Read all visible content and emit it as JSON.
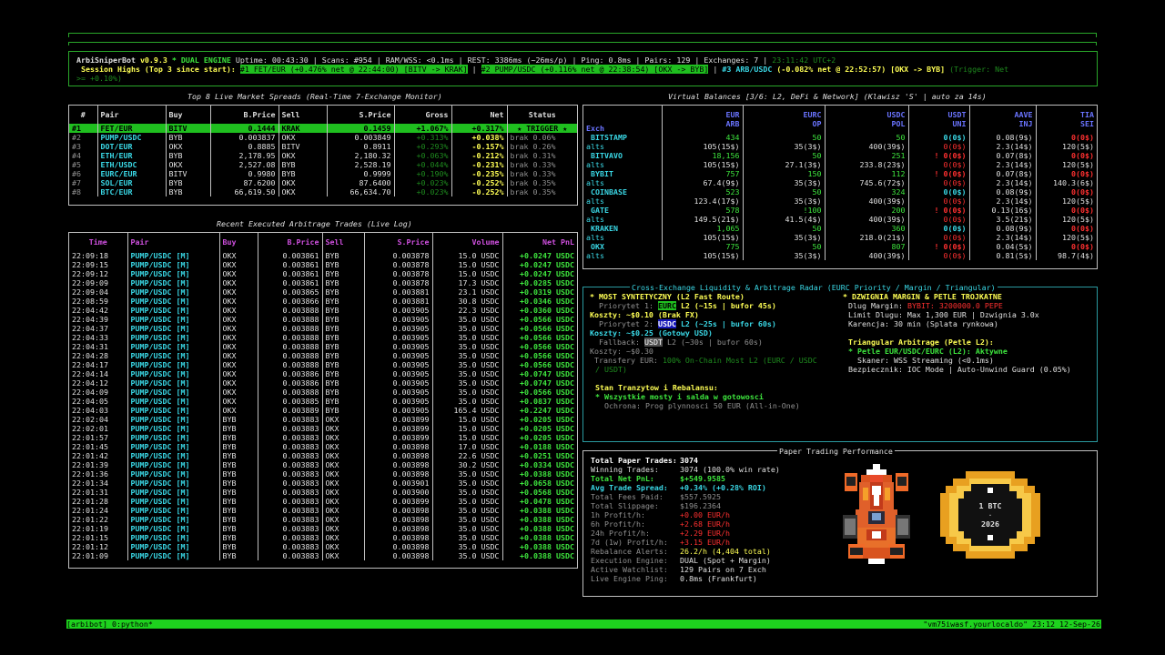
{
  "header": {
    "app": "ArbiSniperBot",
    "version": "v0.9.3",
    "mode": "* DUAL ENGINE",
    "stats": "Uptime: 00:43:30 | Scans: #954 | RAM/WSS: <0.1ms | REST: 3386ms (~26ms/p) | Ping: 0.8ms | Pairs: 129 | Exchanges: 7 |",
    "clock": "23:11:42 UTC+2",
    "session_label": "Session Highs (Top 3 since start):",
    "high1": "#1 FET/EUR (+0.476% net @ 22:44:00) [BITV -> KRAK]",
    "high2": "#2 PUMP/USDC (+0.116% net @ 22:38:54) [OKX -> BYB]",
    "high3_a": "#3 ARB/USDC",
    "high3_b": " (-0.082% net @ 22:52:57) [OKX -> BYB]",
    "trigger_note": "(Trigger: Net",
    "trigger_note2": ">= +0.10%)"
  },
  "spreads": {
    "title": "Top 8 Live Market Spreads (Real-Time 7-Exchange Monitor)",
    "columns": [
      "#",
      "Pair",
      "Buy",
      "B.Price",
      "Sell",
      "S.Price",
      "Gross",
      "Net",
      "Status"
    ],
    "rows": [
      [
        "#1",
        "FET/EUR",
        "BITV",
        "0.1444",
        "KRAK",
        "0.1459",
        "+1.067%",
        "+0.317%",
        "★ TRIGGER ★"
      ],
      [
        "#2",
        "PUMP/USDC",
        "BYB",
        "0.003837",
        "OKX",
        "0.003849",
        "+0.313%",
        "+0.038%",
        "brak 0.06%"
      ],
      [
        "#3",
        "DOT/EUR",
        "OKX",
        "0.8885",
        "BITV",
        "0.8911",
        "+0.293%",
        "-0.157%",
        "brak 0.26%"
      ],
      [
        "#4",
        "ETH/EUR",
        "BYB",
        "2,178.95",
        "OKX",
        "2,180.32",
        "+0.063%",
        "-0.212%",
        "brak 0.31%"
      ],
      [
        "#5",
        "ETH/USDC",
        "OKX",
        "2,527.08",
        "BYB",
        "2,528.19",
        "+0.044%",
        "-0.231%",
        "brak 0.33%"
      ],
      [
        "#6",
        "EURC/EUR",
        "BITV",
        "0.9980",
        "BYB",
        "0.9999",
        "+0.190%",
        "-0.235%",
        "brak 0.33%"
      ],
      [
        "#7",
        "SOL/EUR",
        "BYB",
        "87.6200",
        "OKX",
        "87.6400",
        "+0.023%",
        "-0.252%",
        "brak 0.35%"
      ],
      [
        "#8",
        "BTC/EUR",
        "BYB",
        "66,619.50",
        "OKX",
        "66,634.70",
        "+0.023%",
        "-0.252%",
        "brak 0.35%"
      ]
    ]
  },
  "trades": {
    "title": "Recent Executed Arbitrage Trades (Live Log)",
    "columns": [
      "Time",
      "Pair",
      "Buy",
      "B.Price",
      "Sell",
      "S.Price",
      "Volume",
      "Net PnL"
    ],
    "rows": [
      [
        "22:09:18",
        "PUMP/USDC [M]",
        "OKX",
        "0.003861",
        "BYB",
        "0.003878",
        "15.0 USDC",
        "+0.0247 USDC"
      ],
      [
        "22:09:15",
        "PUMP/USDC [M]",
        "OKX",
        "0.003861",
        "BYB",
        "0.003878",
        "15.0 USDC",
        "+0.0247 USDC"
      ],
      [
        "22:09:12",
        "PUMP/USDC [M]",
        "OKX",
        "0.003861",
        "BYB",
        "0.003878",
        "15.0 USDC",
        "+0.0247 USDC"
      ],
      [
        "22:09:09",
        "PUMP/USDC [M]",
        "OKX",
        "0.003861",
        "BYB",
        "0.003878",
        "17.3 USDC",
        "+0.0285 USDC"
      ],
      [
        "22:09:04",
        "PUMP/USDC [M]",
        "OKX",
        "0.003865",
        "BYB",
        "0.003881",
        "23.1 USDC",
        "+0.0319 USDC"
      ],
      [
        "22:08:59",
        "PUMP/USDC [M]",
        "OKX",
        "0.003866",
        "BYB",
        "0.003881",
        "30.8 USDC",
        "+0.0346 USDC"
      ],
      [
        "22:04:42",
        "PUMP/USDC [M]",
        "OKX",
        "0.003888",
        "BYB",
        "0.003905",
        "22.3 USDC",
        "+0.0360 USDC"
      ],
      [
        "22:04:39",
        "PUMP/USDC [M]",
        "OKX",
        "0.003888",
        "BYB",
        "0.003905",
        "35.0 USDC",
        "+0.0566 USDC"
      ],
      [
        "22:04:37",
        "PUMP/USDC [M]",
        "OKX",
        "0.003888",
        "BYB",
        "0.003905",
        "35.0 USDC",
        "+0.0566 USDC"
      ],
      [
        "22:04:33",
        "PUMP/USDC [M]",
        "OKX",
        "0.003888",
        "BYB",
        "0.003905",
        "35.0 USDC",
        "+0.0566 USDC"
      ],
      [
        "22:04:31",
        "PUMP/USDC [M]",
        "OKX",
        "0.003888",
        "BYB",
        "0.003905",
        "35.0 USDC",
        "+0.0566 USDC"
      ],
      [
        "22:04:28",
        "PUMP/USDC [M]",
        "OKX",
        "0.003888",
        "BYB",
        "0.003905",
        "35.0 USDC",
        "+0.0566 USDC"
      ],
      [
        "22:04:17",
        "PUMP/USDC [M]",
        "OKX",
        "0.003888",
        "BYB",
        "0.003905",
        "35.0 USDC",
        "+0.0566 USDC"
      ],
      [
        "22:04:14",
        "PUMP/USDC [M]",
        "OKX",
        "0.003886",
        "BYB",
        "0.003905",
        "35.0 USDC",
        "+0.0747 USDC"
      ],
      [
        "22:04:12",
        "PUMP/USDC [M]",
        "OKX",
        "0.003886",
        "BYB",
        "0.003905",
        "35.0 USDC",
        "+0.0747 USDC"
      ],
      [
        "22:04:09",
        "PUMP/USDC [M]",
        "OKX",
        "0.003888",
        "BYB",
        "0.003905",
        "35.0 USDC",
        "+0.0566 USDC"
      ],
      [
        "22:04:05",
        "PUMP/USDC [M]",
        "OKX",
        "0.003885",
        "BYB",
        "0.003905",
        "35.0 USDC",
        "+0.0837 USDC"
      ],
      [
        "22:04:03",
        "PUMP/USDC [M]",
        "OKX",
        "0.003889",
        "BYB",
        "0.003905",
        "165.4 USDC",
        "+0.2247 USDC"
      ],
      [
        "22:02:04",
        "PUMP/USDC [M]",
        "BYB",
        "0.003883",
        "OKX",
        "0.003899",
        "15.0 USDC",
        "+0.0205 USDC"
      ],
      [
        "22:02:01",
        "PUMP/USDC [M]",
        "BYB",
        "0.003883",
        "OKX",
        "0.003899",
        "15.0 USDC",
        "+0.0205 USDC"
      ],
      [
        "22:01:57",
        "PUMP/USDC [M]",
        "BYB",
        "0.003883",
        "OKX",
        "0.003899",
        "15.0 USDC",
        "+0.0205 USDC"
      ],
      [
        "22:01:45",
        "PUMP/USDC [M]",
        "BYB",
        "0.003883",
        "OKX",
        "0.003898",
        "17.0 USDC",
        "+0.0188 USDC"
      ],
      [
        "22:01:42",
        "PUMP/USDC [M]",
        "BYB",
        "0.003883",
        "OKX",
        "0.003898",
        "22.6 USDC",
        "+0.0251 USDC"
      ],
      [
        "22:01:39",
        "PUMP/USDC [M]",
        "BYB",
        "0.003883",
        "OKX",
        "0.003898",
        "30.2 USDC",
        "+0.0334 USDC"
      ],
      [
        "22:01:36",
        "PUMP/USDC [M]",
        "BYB",
        "0.003883",
        "OKX",
        "0.003898",
        "35.0 USDC",
        "+0.0388 USDC"
      ],
      [
        "22:01:34",
        "PUMP/USDC [M]",
        "BYB",
        "0.003883",
        "OKX",
        "0.003901",
        "35.0 USDC",
        "+0.0658 USDC"
      ],
      [
        "22:01:31",
        "PUMP/USDC [M]",
        "BYB",
        "0.003883",
        "OKX",
        "0.003900",
        "35.0 USDC",
        "+0.0568 USDC"
      ],
      [
        "22:01:28",
        "PUMP/USDC [M]",
        "BYB",
        "0.003883",
        "OKX",
        "0.003899",
        "35.0 USDC",
        "+0.0478 USDC"
      ],
      [
        "22:01:24",
        "PUMP/USDC [M]",
        "BYB",
        "0.003883",
        "OKX",
        "0.003898",
        "35.0 USDC",
        "+0.0388 USDC"
      ],
      [
        "22:01:22",
        "PUMP/USDC [M]",
        "BYB",
        "0.003883",
        "OKX",
        "0.003898",
        "35.0 USDC",
        "+0.0388 USDC"
      ],
      [
        "22:01:19",
        "PUMP/USDC [M]",
        "BYB",
        "0.003883",
        "OKX",
        "0.003898",
        "35.0 USDC",
        "+0.0388 USDC"
      ],
      [
        "22:01:15",
        "PUMP/USDC [M]",
        "BYB",
        "0.003883",
        "OKX",
        "0.003898",
        "35.0 USDC",
        "+0.0388 USDC"
      ],
      [
        "22:01:12",
        "PUMP/USDC [M]",
        "BYB",
        "0.003883",
        "OKX",
        "0.003898",
        "35.0 USDC",
        "+0.0388 USDC"
      ],
      [
        "22:01:09",
        "PUMP/USDC [M]",
        "BYB",
        "0.003883",
        "OKX",
        "0.003898",
        "35.0 USDC",
        "+0.0388 USDC"
      ]
    ]
  },
  "balances": {
    "title": "Virtual Balances [3/6: L2, DeFi & Network] (Klawisz 'S' | auto za 14s)",
    "exch_label": "Exch",
    "columns": [
      [
        "EUR",
        "ARB"
      ],
      [
        "EURC",
        "OP"
      ],
      [
        "USDC",
        "POL"
      ],
      [
        "USDT",
        "UNI"
      ],
      [
        "AAVE",
        "INJ"
      ],
      [
        "TIA",
        "SEI"
      ]
    ],
    "rows": [
      {
        "name": "BITSTAMP",
        "main": [
          "434",
          "50",
          "50",
          "0(0$)",
          "0.08(9$)",
          "0(0$)"
        ],
        "alts": [
          "105(15$)",
          "35(3$)",
          "400(39$)",
          "0(0$)",
          "2.3(14$)",
          "120(5$)"
        ]
      },
      {
        "name": "BITVAVO",
        "main": [
          "18,156",
          "50",
          "251",
          "! 0(0$)",
          "0.07(8$)",
          "0(0$)"
        ],
        "alts": [
          "105(15$)",
          "27.1(3$)",
          "233.8(23$)",
          "0(0$)",
          "2.3(14$)",
          "120(5$)"
        ]
      },
      {
        "name": "BYBIT",
        "main": [
          "757",
          "150",
          "112",
          "! 0(0$)",
          "0.07(8$)",
          "0(0$)"
        ],
        "alts": [
          "67.4(9$)",
          "35(3$)",
          "745.6(72$)",
          "0(0$)",
          "2.3(14$)",
          "140.3(6$)"
        ]
      },
      {
        "name": "COINBASE",
        "main": [
          "523",
          "50",
          "324",
          "0(0$)",
          "0.08(9$)",
          "0(0$)"
        ],
        "alts": [
          "123.4(17$)",
          "35(3$)",
          "400(39$)",
          "0(0$)",
          "2.3(14$)",
          "120(5$)"
        ]
      },
      {
        "name": "GATE",
        "main": [
          "578",
          "!100",
          "200",
          "! 0(0$)",
          "0.13(16$)",
          "0(0$)"
        ],
        "alts": [
          "149.5(21$)",
          "41.5(4$)",
          "400(39$)",
          "0(0$)",
          "3.5(21$)",
          "120(5$)"
        ]
      },
      {
        "name": "KRAKEN",
        "main": [
          "1,065",
          "50",
          "360",
          "0(0$)",
          "0.08(9$)",
          "0(0$)"
        ],
        "alts": [
          "105(15$)",
          "35(3$)",
          "218.0(21$)",
          "0(0$)",
          "2.3(14$)",
          "120(5$)"
        ]
      },
      {
        "name": "OKX",
        "main": [
          "775",
          "50",
          "807",
          "! 0(0$)",
          "0.04(5$)",
          "0(0$)"
        ],
        "alts": [
          "105(15$)",
          "35(3$)",
          "400(39$)",
          "0(0$)",
          "0.81(5$)",
          "98.7(4$)"
        ]
      }
    ],
    "alts_label": "alts"
  },
  "radar": {
    "title": "Cross-Exchange Liquidity & Arbitrage Radar (EURC Priority / Margin / Triangular)",
    "left": {
      "head": "* MOST SYNTETYCZNY (L2 Fast Route)",
      "p1_label": "Priorytet 1:",
      "p1_token": "EURC",
      "p1_text": "L2 (~15s | bufor 45s)",
      "cost1": "Koszty: ~$0.10 (Brak FX)",
      "p2_label": "Priorytet 2:",
      "p2_token": "USDC",
      "p2_text": "L2 (~25s | bufor 60s)",
      "cost2": "Koszty: ~$0.25 (Gotowy USD)",
      "fb_label": "Fallback:",
      "fb_token": "USDT",
      "fb_text": "L2 (~30s | bufor 60s)",
      "cost3": "Koszty: ~$0.30",
      "transfer_label": "Transfery EUR:",
      "transfer_text": "100% On-Chain Most L2 (EURC / USDC",
      "transfer_text2": "/ USDT)",
      "stan_head": "Stan Tranzytow i Rebalansu:",
      "stan_line": "* Wszystkie mosty i salda w gotowosci",
      "ochrona": "Ochrona: Prog plynnosci 50 EUR (All-in-One)"
    },
    "right": {
      "head": "* DZWIGNIA MARGIN & PETLE TROJKATNE",
      "dlug_label": "Dlug Margin:",
      "dlug_val": "BYBIT: 3200000.0 PEPE",
      "limit": "Limit Dlugu: Max 1,300 EUR | Dzwignia 3.0x",
      "karencja": "Karencja:     30 min (Splata rynkowa)",
      "tri_head": "Triangular Arbitrage (Petle L2):",
      "tri_line": "* Petle EUR/USDC/EURC (L2): Aktywne",
      "skaner": "Skaner: WSS Streaming (<0.1ms)",
      "bezp": "Bezpiecznik: IOC Mode | Auto-Unwind Guard (0.05%)"
    }
  },
  "paper": {
    "title": "Paper Trading Performance",
    "rows": [
      [
        "Total Paper Trades:",
        "3074"
      ],
      [
        "Winning Trades:",
        "3074 (100.0% win rate)"
      ],
      [
        "Total Net PnL:",
        "$+549.9585"
      ],
      [
        "Avg Trade Spread:",
        "+0.34% (+0.28% ROI)"
      ],
      [
        "Total Fees Paid:",
        "$557.5925"
      ],
      [
        "Total Slippage:",
        "$196.2364"
      ],
      [
        "1h Profit/h:",
        "+0.00 EUR/h"
      ],
      [
        "6h Profit/h:",
        "+2.68 EUR/h"
      ],
      [
        "24h Profit/h:",
        "+2.29 EUR/h"
      ],
      [
        "7d (1w) Profit/h:",
        "+3.15 EUR/h"
      ],
      [
        "Rebalance Alerts:",
        "26.2/h (4,404 total)"
      ],
      [
        "Execution Engine:",
        "DUAL (Spot + Margin)"
      ],
      [
        "Active Watchlist:",
        "129 Pairs on 7 Exch"
      ],
      [
        "Live Engine Ping:",
        "0.8ms (Frankfurt)"
      ]
    ],
    "coin_line1": "1 BTC",
    "coin_line2": "2026"
  },
  "statusbar": {
    "left": "[arbibot] 0:python*",
    "right": "\"vm75iwasf.yourlocaldo\" 23:12 12-Sep-26"
  },
  "colors": {
    "green": "#3ee63e",
    "cyan": "#3ad8e6",
    "yellow": "#ffff55",
    "red": "#ff3030",
    "magenta": "#d050e0",
    "blue": "#6a74ff"
  }
}
